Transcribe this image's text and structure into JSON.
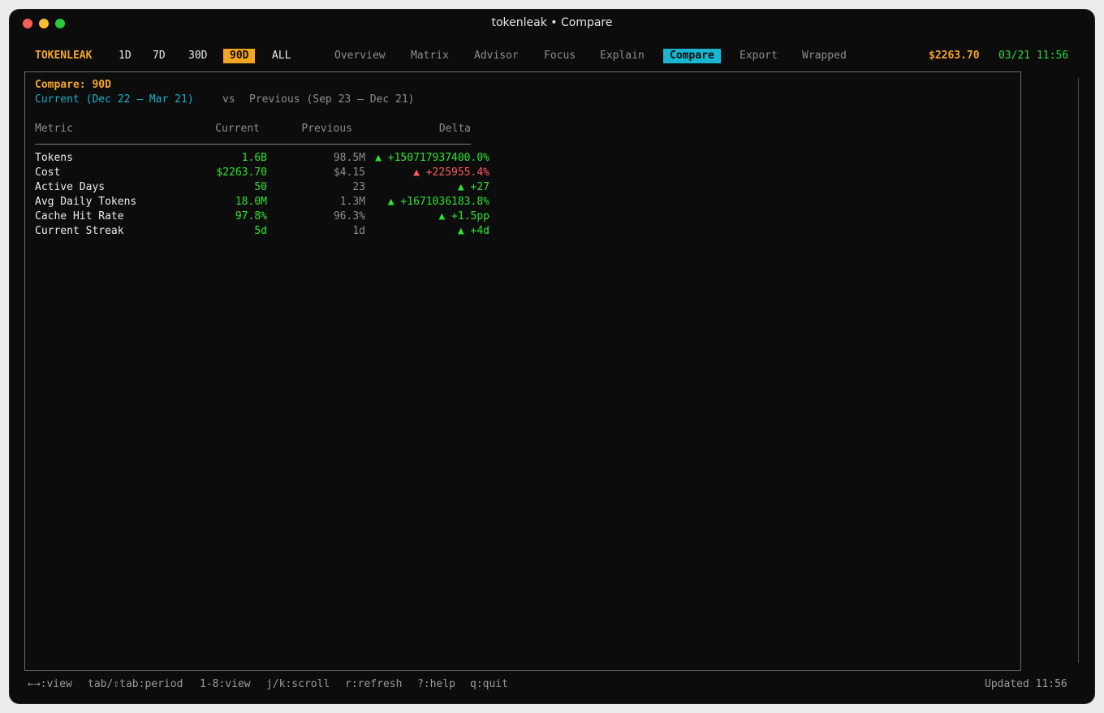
{
  "window": {
    "title": "tokenleak • Compare"
  },
  "header": {
    "brand": "TOKENLEAK",
    "periods": [
      "1D",
      "7D",
      "30D",
      "90D",
      "ALL"
    ],
    "active_period": "90D",
    "tabs": [
      "Overview",
      "Matrix",
      "Advisor",
      "Focus",
      "Explain",
      "Compare",
      "Export",
      "Wrapped"
    ],
    "active_tab": "Compare",
    "total_cost": "$2263.70",
    "datetime": "03/21 11:56"
  },
  "compare": {
    "title": "Compare: 90D",
    "current_range": "Current (Dec 22 – Mar 21)",
    "vs": "vs",
    "previous_range": "Previous (Sep 23 – Dec 21)",
    "columns": {
      "metric": "Metric",
      "current": "Current",
      "previous": "Previous",
      "delta": "Delta"
    },
    "rows": [
      {
        "metric": "Tokens",
        "current": "1.6B",
        "previous": "98.5M",
        "delta": "▲ +150717937400.0%",
        "delta_color": "#2be52e"
      },
      {
        "metric": "Cost",
        "current": "$2263.70",
        "previous": "$4.15",
        "delta": "▲ +225955.4%",
        "delta_color": "#ff5a5a"
      },
      {
        "metric": "Active Days",
        "current": "50",
        "previous": "23",
        "delta": "▲ +27",
        "delta_color": "#2be52e"
      },
      {
        "metric": "Avg Daily Tokens",
        "current": "18.0M",
        "previous": "1.3M",
        "delta": "▲ +1671036183.8%",
        "delta_color": "#2be52e"
      },
      {
        "metric": "Cache Hit Rate",
        "current": "97.8%",
        "previous": "96.3%",
        "delta": "▲ +1.5pp",
        "delta_color": "#2be52e"
      },
      {
        "metric": "Current Streak",
        "current": "5d",
        "previous": "1d",
        "delta": "▲ +4d",
        "delta_color": "#2be52e"
      }
    ]
  },
  "footer": {
    "hints": [
      "←→:view",
      "tab/⇧tab:period",
      "1-8:view",
      "j/k:scroll",
      "r:refresh",
      "?:help",
      "q:quit"
    ],
    "updated": "Updated 11:56"
  },
  "colors": {
    "accent_orange": "#f5a524",
    "accent_cyan": "#19b6d2",
    "positive": "#2be52e",
    "negative": "#ff5a5a"
  }
}
